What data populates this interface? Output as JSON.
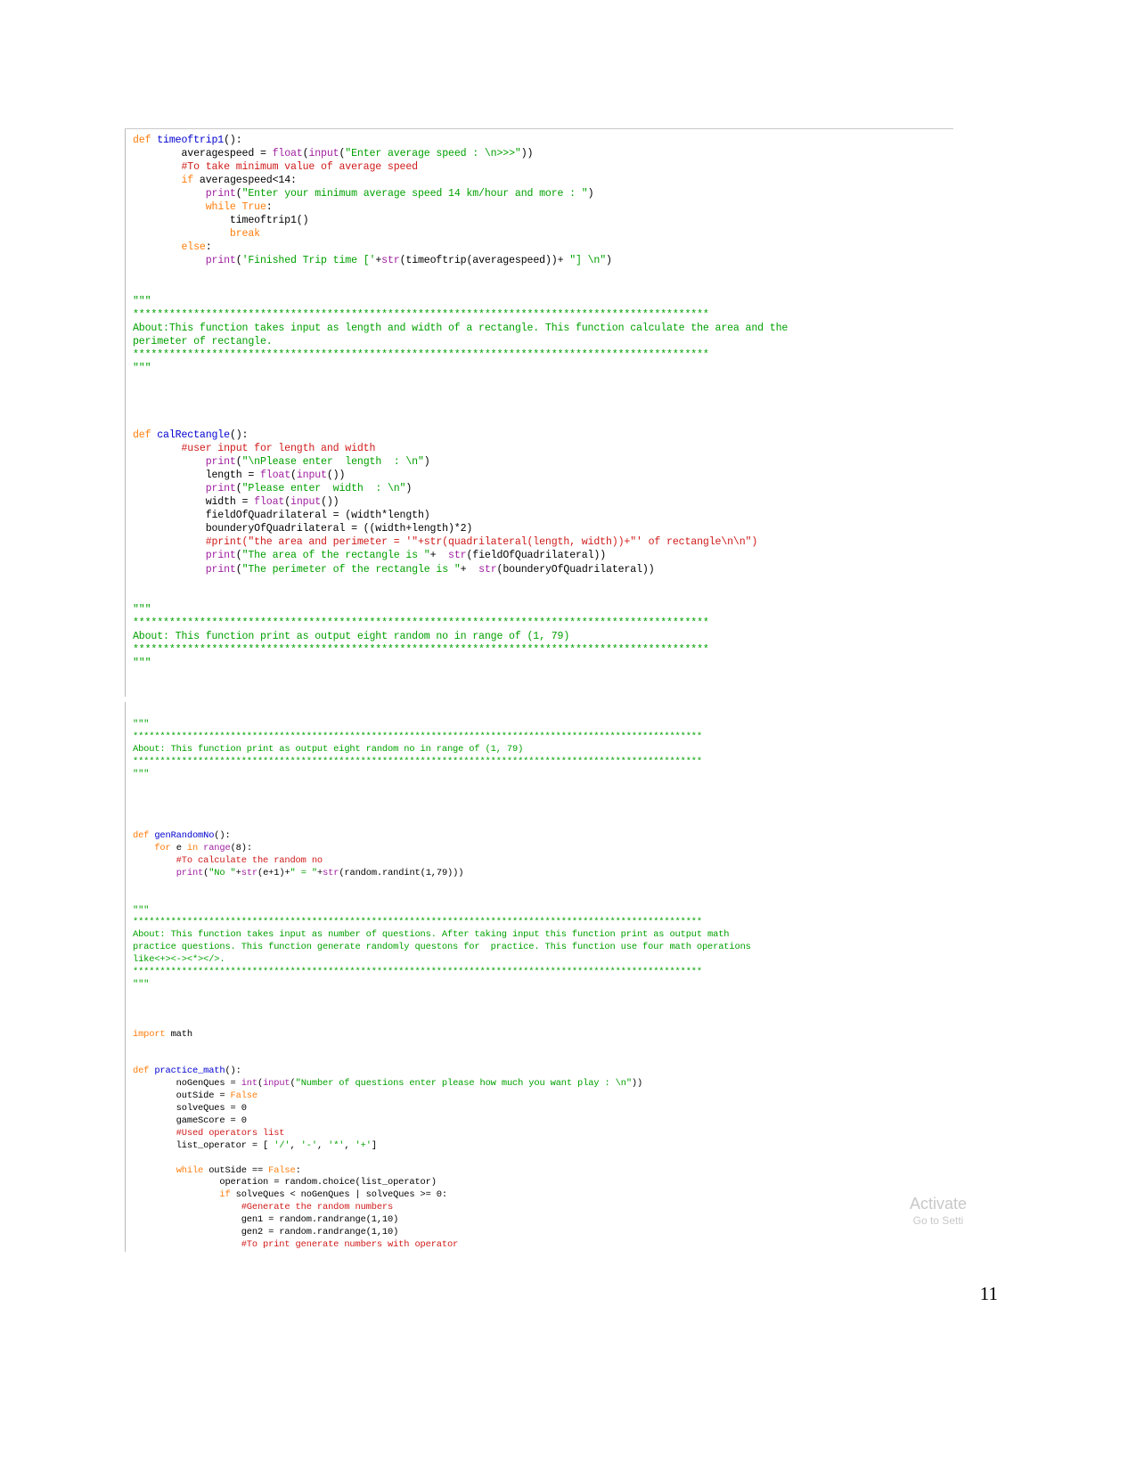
{
  "document": {
    "page_number": "11",
    "watermark": {
      "title": "Activate",
      "subtitle": "Go to Setti"
    }
  },
  "code_block_one": {
    "language": "python",
    "lines": [
      [
        {
          "t": "def ",
          "c": "kw"
        },
        {
          "t": "timeoftrip1",
          "c": "fn"
        },
        {
          "t": "():",
          "c": "op"
        }
      ],
      [
        {
          "t": "        averagespeed = ",
          "c": "op"
        },
        {
          "t": "float",
          "c": "bi"
        },
        {
          "t": "(",
          "c": "op"
        },
        {
          "t": "input",
          "c": "bi"
        },
        {
          "t": "(",
          "c": "op"
        },
        {
          "t": "\"Enter average speed : \\n>>>\"",
          "c": "str"
        },
        {
          "t": "))",
          "c": "op"
        }
      ],
      [
        {
          "t": "        #To take minimum value of average speed",
          "c": "cmt"
        }
      ],
      [
        {
          "t": "        ",
          "c": "op"
        },
        {
          "t": "if",
          "c": "kw"
        },
        {
          "t": " averagespeed<14:",
          "c": "op"
        }
      ],
      [
        {
          "t": "            ",
          "c": "op"
        },
        {
          "t": "print",
          "c": "bi"
        },
        {
          "t": "(",
          "c": "op"
        },
        {
          "t": "\"Enter your minimum average speed 14 km/hour and more : \"",
          "c": "str"
        },
        {
          "t": ")",
          "c": "op"
        }
      ],
      [
        {
          "t": "            ",
          "c": "op"
        },
        {
          "t": "while True",
          "c": "kw"
        },
        {
          "t": ":",
          "c": "op"
        }
      ],
      [
        {
          "t": "                timeoftrip1()",
          "c": "op"
        }
      ],
      [
        {
          "t": "                ",
          "c": "op"
        },
        {
          "t": "break",
          "c": "kw"
        }
      ],
      [
        {
          "t": "        ",
          "c": "op"
        },
        {
          "t": "else",
          "c": "kw"
        },
        {
          "t": ":",
          "c": "op"
        }
      ],
      [
        {
          "t": "            ",
          "c": "op"
        },
        {
          "t": "print",
          "c": "bi"
        },
        {
          "t": "(",
          "c": "op"
        },
        {
          "t": "'Finished Trip time ['",
          "c": "str"
        },
        {
          "t": "+",
          "c": "op"
        },
        {
          "t": "str",
          "c": "bi"
        },
        {
          "t": "(timeoftrip(averagespeed))+ ",
          "c": "op"
        },
        {
          "t": "\"] \\n\"",
          "c": "str"
        },
        {
          "t": ")",
          "c": "op"
        }
      ],
      [
        {
          "t": "",
          "c": "op"
        }
      ],
      [
        {
          "t": "",
          "c": "op"
        }
      ],
      [
        {
          "t": "\"\"\"",
          "c": "doc"
        }
      ],
      [
        {
          "t": "***********************************************************************************************",
          "c": "doc"
        }
      ],
      [
        {
          "t": "About:This function takes input as length and width of a rectangle. This function calculate the area and the",
          "c": "doc"
        }
      ],
      [
        {
          "t": "perimeter of rectangle.",
          "c": "doc"
        }
      ],
      [
        {
          "t": "***********************************************************************************************",
          "c": "doc"
        }
      ],
      [
        {
          "t": "\"\"\"",
          "c": "doc"
        }
      ],
      [
        {
          "t": "",
          "c": "op"
        }
      ],
      [
        {
          "t": "",
          "c": "op"
        }
      ],
      [
        {
          "t": "",
          "c": "op"
        }
      ],
      [
        {
          "t": "",
          "c": "op"
        }
      ],
      [
        {
          "t": "def ",
          "c": "kw"
        },
        {
          "t": "calRectangle",
          "c": "fn"
        },
        {
          "t": "():",
          "c": "op"
        }
      ],
      [
        {
          "t": "        #user input for length and width",
          "c": "cmt"
        }
      ],
      [
        {
          "t": "            ",
          "c": "op"
        },
        {
          "t": "print",
          "c": "bi"
        },
        {
          "t": "(",
          "c": "op"
        },
        {
          "t": "\"\\nPlease enter  length  : \\n\"",
          "c": "str"
        },
        {
          "t": ")",
          "c": "op"
        }
      ],
      [
        {
          "t": "            length = ",
          "c": "op"
        },
        {
          "t": "float",
          "c": "bi"
        },
        {
          "t": "(",
          "c": "op"
        },
        {
          "t": "input",
          "c": "bi"
        },
        {
          "t": "())",
          "c": "op"
        }
      ],
      [
        {
          "t": "            ",
          "c": "op"
        },
        {
          "t": "print",
          "c": "bi"
        },
        {
          "t": "(",
          "c": "op"
        },
        {
          "t": "\"Please enter  width  : \\n\"",
          "c": "str"
        },
        {
          "t": ")",
          "c": "op"
        }
      ],
      [
        {
          "t": "            width = ",
          "c": "op"
        },
        {
          "t": "float",
          "c": "bi"
        },
        {
          "t": "(",
          "c": "op"
        },
        {
          "t": "input",
          "c": "bi"
        },
        {
          "t": "())",
          "c": "op"
        }
      ],
      [
        {
          "t": "            fieldOfQuadrilateral = (width*length)",
          "c": "op"
        }
      ],
      [
        {
          "t": "            bounderyOfQuadrilateral = ((width+length)*2)",
          "c": "op"
        }
      ],
      [
        {
          "t": "            #print(\"the area and perimeter = '\"+str(quadrilateral(length, width))+\"' of rectangle\\n\\n\")",
          "c": "cmt"
        }
      ],
      [
        {
          "t": "            ",
          "c": "op"
        },
        {
          "t": "print",
          "c": "bi"
        },
        {
          "t": "(",
          "c": "op"
        },
        {
          "t": "\"The area of the rectangle is \"",
          "c": "str"
        },
        {
          "t": "+  ",
          "c": "op"
        },
        {
          "t": "str",
          "c": "bi"
        },
        {
          "t": "(fieldOfQuadrilateral))",
          "c": "op"
        }
      ],
      [
        {
          "t": "            ",
          "c": "op"
        },
        {
          "t": "print",
          "c": "bi"
        },
        {
          "t": "(",
          "c": "op"
        },
        {
          "t": "\"The perimeter of the rectangle is \"",
          "c": "str"
        },
        {
          "t": "+  ",
          "c": "op"
        },
        {
          "t": "str",
          "c": "bi"
        },
        {
          "t": "(bounderyOfQuadrilateral))",
          "c": "op"
        }
      ],
      [
        {
          "t": "",
          "c": "op"
        }
      ],
      [
        {
          "t": "",
          "c": "op"
        }
      ],
      [
        {
          "t": "\"\"\"",
          "c": "doc"
        }
      ],
      [
        {
          "t": "***********************************************************************************************",
          "c": "doc"
        }
      ],
      [
        {
          "t": "About: This function print as output eight random no in range of (1, 79)",
          "c": "doc"
        }
      ],
      [
        {
          "t": "***********************************************************************************************",
          "c": "doc"
        }
      ],
      [
        {
          "t": "\"\"\"",
          "c": "doc"
        }
      ],
      [
        {
          "t": "",
          "c": "op"
        }
      ],
      [
        {
          "t": "",
          "c": "op"
        }
      ]
    ]
  },
  "code_block_two": {
    "language": "python",
    "lines": [
      [
        {
          "t": "",
          "c": "op"
        }
      ],
      [
        {
          "t": "\"\"\"",
          "c": "doc"
        }
      ],
      [
        {
          "t": "*********************************************************************************************************",
          "c": "doc"
        }
      ],
      [
        {
          "t": "About: This function print as output eight random no in range of (1, 79)",
          "c": "doc"
        }
      ],
      [
        {
          "t": "*********************************************************************************************************",
          "c": "doc"
        }
      ],
      [
        {
          "t": "\"\"\"",
          "c": "doc"
        }
      ],
      [
        {
          "t": "",
          "c": "op"
        }
      ],
      [
        {
          "t": "",
          "c": "op"
        }
      ],
      [
        {
          "t": "",
          "c": "op"
        }
      ],
      [
        {
          "t": "",
          "c": "op"
        }
      ],
      [
        {
          "t": "def ",
          "c": "kw"
        },
        {
          "t": "genRandomNo",
          "c": "fn"
        },
        {
          "t": "():",
          "c": "op"
        }
      ],
      [
        {
          "t": "    ",
          "c": "op"
        },
        {
          "t": "for",
          "c": "kw"
        },
        {
          "t": " e ",
          "c": "op"
        },
        {
          "t": "in",
          "c": "kw"
        },
        {
          "t": " ",
          "c": "op"
        },
        {
          "t": "range",
          "c": "bi"
        },
        {
          "t": "(8):",
          "c": "op"
        }
      ],
      [
        {
          "t": "        #To calculate the random no",
          "c": "cmt"
        }
      ],
      [
        {
          "t": "        ",
          "c": "op"
        },
        {
          "t": "print",
          "c": "bi"
        },
        {
          "t": "(",
          "c": "op"
        },
        {
          "t": "\"No \"",
          "c": "str"
        },
        {
          "t": "+",
          "c": "op"
        },
        {
          "t": "str",
          "c": "bi"
        },
        {
          "t": "(e+1)+",
          "c": "op"
        },
        {
          "t": "\" = \"",
          "c": "str"
        },
        {
          "t": "+",
          "c": "op"
        },
        {
          "t": "str",
          "c": "bi"
        },
        {
          "t": "(random.randint(1,79)))",
          "c": "op"
        }
      ],
      [
        {
          "t": "",
          "c": "op"
        }
      ],
      [
        {
          "t": "",
          "c": "op"
        }
      ],
      [
        {
          "t": "\"\"\"",
          "c": "doc"
        }
      ],
      [
        {
          "t": "*********************************************************************************************************",
          "c": "doc"
        }
      ],
      [
        {
          "t": "About: This function takes input as number of questions. After taking input this function print as output math",
          "c": "doc"
        }
      ],
      [
        {
          "t": "practice questions. This function generate randomly questons for  practice. This function use four math operations",
          "c": "doc"
        }
      ],
      [
        {
          "t": "like<+><-><*></>.",
          "c": "doc"
        }
      ],
      [
        {
          "t": "*********************************************************************************************************",
          "c": "doc"
        }
      ],
      [
        {
          "t": "\"\"\"",
          "c": "doc"
        }
      ],
      [
        {
          "t": "",
          "c": "op"
        }
      ],
      [
        {
          "t": "",
          "c": "op"
        }
      ],
      [
        {
          "t": "",
          "c": "op"
        }
      ],
      [
        {
          "t": "import",
          "c": "kw"
        },
        {
          "t": " math",
          "c": "op"
        }
      ],
      [
        {
          "t": "",
          "c": "op"
        }
      ],
      [
        {
          "t": "",
          "c": "op"
        }
      ],
      [
        {
          "t": "def ",
          "c": "kw"
        },
        {
          "t": "practice_math",
          "c": "fn"
        },
        {
          "t": "():",
          "c": "op"
        }
      ],
      [
        {
          "t": "        noGenQues = ",
          "c": "op"
        },
        {
          "t": "int",
          "c": "bi"
        },
        {
          "t": "(",
          "c": "op"
        },
        {
          "t": "input",
          "c": "bi"
        },
        {
          "t": "(",
          "c": "op"
        },
        {
          "t": "\"Number of questions enter please how much you want play : \\n\"",
          "c": "str"
        },
        {
          "t": "))",
          "c": "op"
        }
      ],
      [
        {
          "t": "        outSide = ",
          "c": "op"
        },
        {
          "t": "False",
          "c": "kw"
        }
      ],
      [
        {
          "t": "        solveQues = 0",
          "c": "op"
        }
      ],
      [
        {
          "t": "        gameScore = 0",
          "c": "op"
        }
      ],
      [
        {
          "t": "        #Used operators list",
          "c": "cmt"
        }
      ],
      [
        {
          "t": "        list_operator = [ ",
          "c": "op"
        },
        {
          "t": "'/'",
          "c": "str"
        },
        {
          "t": ", ",
          "c": "op"
        },
        {
          "t": "'-'",
          "c": "str"
        },
        {
          "t": ", ",
          "c": "op"
        },
        {
          "t": "'*'",
          "c": "str"
        },
        {
          "t": ", ",
          "c": "op"
        },
        {
          "t": "'+'",
          "c": "str"
        },
        {
          "t": "]",
          "c": "op"
        }
      ],
      [
        {
          "t": "",
          "c": "op"
        }
      ],
      [
        {
          "t": "        ",
          "c": "op"
        },
        {
          "t": "while",
          "c": "kw"
        },
        {
          "t": " outSide == ",
          "c": "op"
        },
        {
          "t": "False",
          "c": "kw"
        },
        {
          "t": ":",
          "c": "op"
        }
      ],
      [
        {
          "t": "                operation = random.choice(list_operator)",
          "c": "op"
        }
      ],
      [
        {
          "t": "                ",
          "c": "op"
        },
        {
          "t": "if",
          "c": "kw"
        },
        {
          "t": " solveQues < noGenQues | solveQues >= 0:",
          "c": "op"
        }
      ],
      [
        {
          "t": "                    #Generate the random numbers",
          "c": "cmt"
        }
      ],
      [
        {
          "t": "                    gen1 = random.randrange(1,10)",
          "c": "op"
        }
      ],
      [
        {
          "t": "                    gen2 = random.randrange(1,10)",
          "c": "op"
        }
      ],
      [
        {
          "t": "                    #To print generate numbers with operator",
          "c": "cmt"
        }
      ]
    ]
  }
}
